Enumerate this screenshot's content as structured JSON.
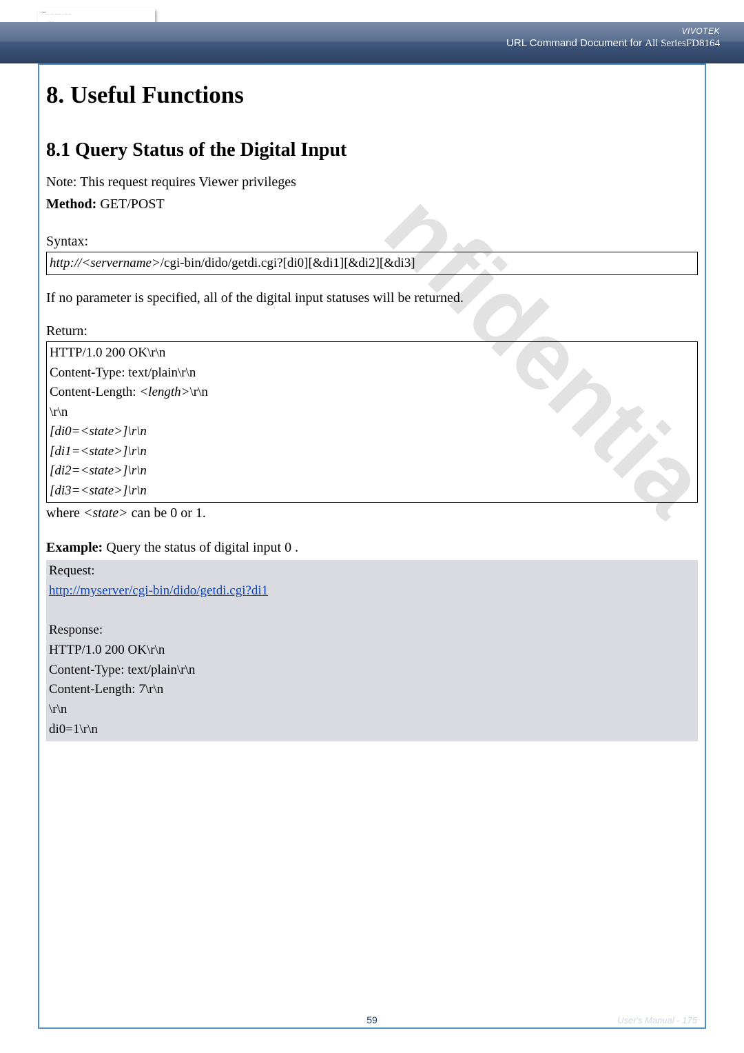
{
  "header": {
    "brand": "VIVOTEK",
    "subtitle_prefix": "URL Command Document for ",
    "subtitle_series": "All Series",
    "subtitle_model": "FD8164"
  },
  "content": {
    "h1": "8. Useful Functions",
    "h2": "8.1 Query Status of the Digital Input",
    "note": "Note: This request requires Viewer privileges",
    "method_label": "Method:",
    "method_value": " GET/POST",
    "syntax_label": "Syntax:",
    "syntax_url": "http://<servername>/cgi-bin/dido/getdi.cgi?[di0][&di1][&di2][&di3]",
    "no_param": "If no parameter is specified, all of the digital input statuses will be returned.",
    "return_label": "Return:",
    "return_lines": {
      "l1": "HTTP/1.0 200 OK\\r\\n",
      "l2": "Content-Type: text/plain\\r\\n",
      "l3_prefix": "Content-Length: ",
      "l3_italic": "<length>",
      "l3_suffix": "\\r\\n",
      "l4": "\\r\\n",
      "l5": "[di0=<state>]\\r\\n",
      "l6": "[di1=<state>]\\r\\n",
      "l7": "[di2=<state>]\\r\\n",
      "l8": "[di3=<state>]\\r\\n"
    },
    "where_prefix": "where ",
    "where_italic": "<state>",
    "where_suffix": " can be 0 or 1.",
    "example_label": "Example:",
    "example_text": " Query the status of digital input 0 .",
    "request_label": "Request:",
    "request_url": "http://myserver/cgi-bin/dido/getdi.cgi?di1",
    "response_label": "Response:",
    "response_lines": {
      "r1": "HTTP/1.0 200 OK\\r\\n",
      "r2": "Content-Type: text/plain\\r\\n",
      "r3": "Content-Length: 7\\r\\n",
      "r4": "\\r\\n",
      "r5": "di0=1\\r\\n"
    }
  },
  "footer": {
    "page_number": "59",
    "right_text": "User's Manual - 175"
  }
}
